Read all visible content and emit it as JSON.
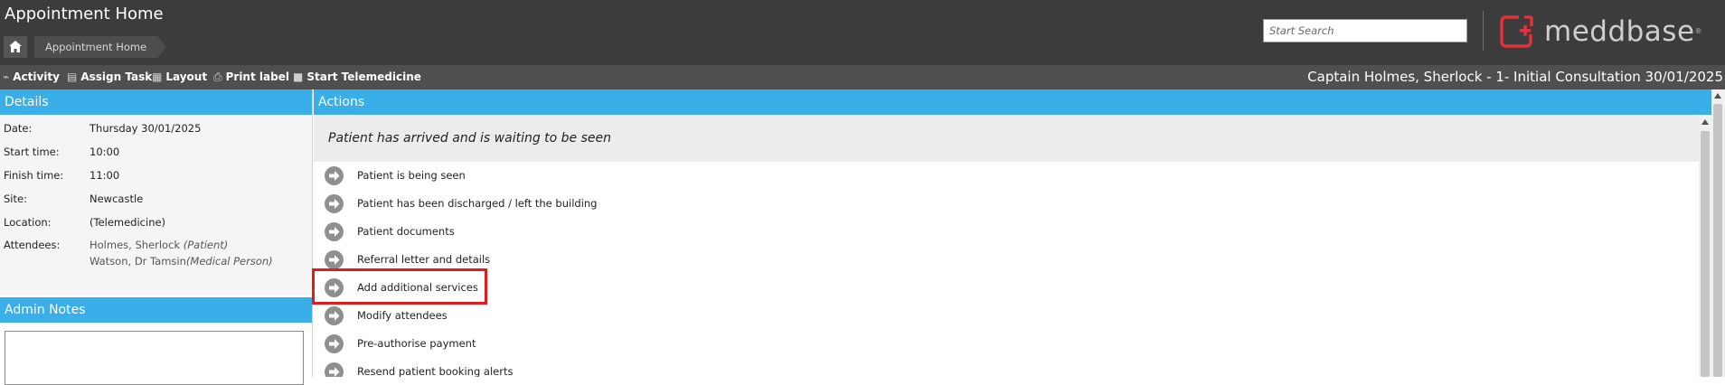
{
  "header": {
    "app_title": "Appointment Home",
    "breadcrumb": "Appointment Home",
    "search_placeholder": "Start Search",
    "logo_text": "meddbase",
    "logo_mark": "®"
  },
  "toolbar": {
    "items": [
      {
        "icon": "activity-icon",
        "label": "Activity"
      },
      {
        "icon": "clipboard-icon",
        "label": "Assign Task"
      },
      {
        "icon": "layout-icon",
        "label": "Layout"
      },
      {
        "icon": "printer-icon",
        "label": "Print label"
      },
      {
        "icon": "video-camera-icon",
        "label": "Start Telemedicine"
      }
    ],
    "appointment_title": "Captain Holmes, Sherlock - 1- Initial Consultation 30/01/2025"
  },
  "details": {
    "heading": "Details",
    "date_label": "Date:",
    "date_value": "Thursday 30/01/2025",
    "start_label": "Start time:",
    "start_value": "10:00",
    "finish_label": "Finish time:",
    "finish_value": "11:00",
    "site_label": "Site:",
    "site_value": "Newcastle",
    "location_label": "Location:",
    "location_value": "(Telemedicine)",
    "attendees_label": "Attendees:",
    "attendee1_name": "Holmes, Sherlock ",
    "attendee1_role": "(Patient)",
    "attendee2_name": "Watson, Dr Tamsin",
    "attendee2_role": "(Medical Person)"
  },
  "admin_notes": {
    "heading": "Admin Notes"
  },
  "actions": {
    "heading": "Actions",
    "status": "Patient has arrived and is waiting to be seen",
    "items": [
      "Patient is being seen",
      "Patient has been discharged / left the building",
      "Patient documents",
      "Referral letter and details",
      "Add additional services",
      "Modify attendees",
      "Pre-authorise payment",
      "Resend patient booking alerts"
    ]
  },
  "colors": {
    "header_bg": "#3c3c3c",
    "toolbar_bg": "#4f4f4f",
    "panel_header": "#3aaee8",
    "highlight": "#e51b1b",
    "logo_red": "#e0323c"
  }
}
